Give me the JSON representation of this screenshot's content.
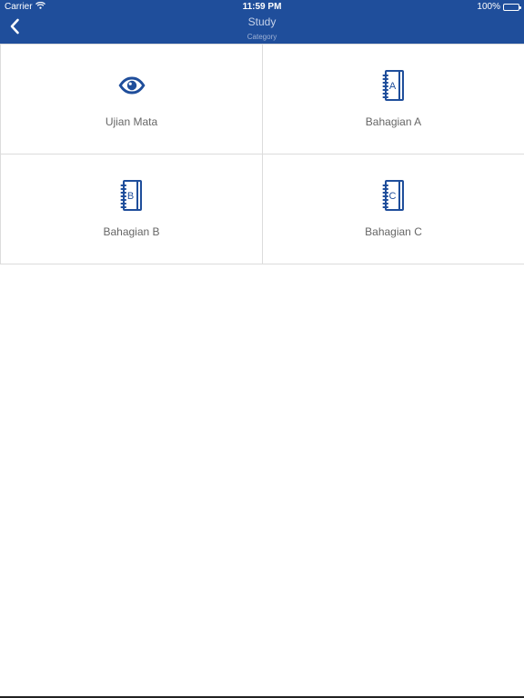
{
  "status": {
    "carrier": "Carrier",
    "time": "11:59 PM",
    "battery": "100%"
  },
  "nav": {
    "title": "Study",
    "subtitle": "Category"
  },
  "tiles": [
    {
      "label": "Ujian Mata",
      "icon": "eye-icon"
    },
    {
      "label": "Bahagian A",
      "icon": "notebook-a-icon",
      "letter": "A"
    },
    {
      "label": "Bahagian B",
      "icon": "notebook-b-icon",
      "letter": "B"
    },
    {
      "label": "Bahagian C",
      "icon": "notebook-c-icon",
      "letter": "C"
    }
  ],
  "colors": {
    "header": "#1f4e9b",
    "icon": "#1f4e9b",
    "label": "#666666"
  }
}
